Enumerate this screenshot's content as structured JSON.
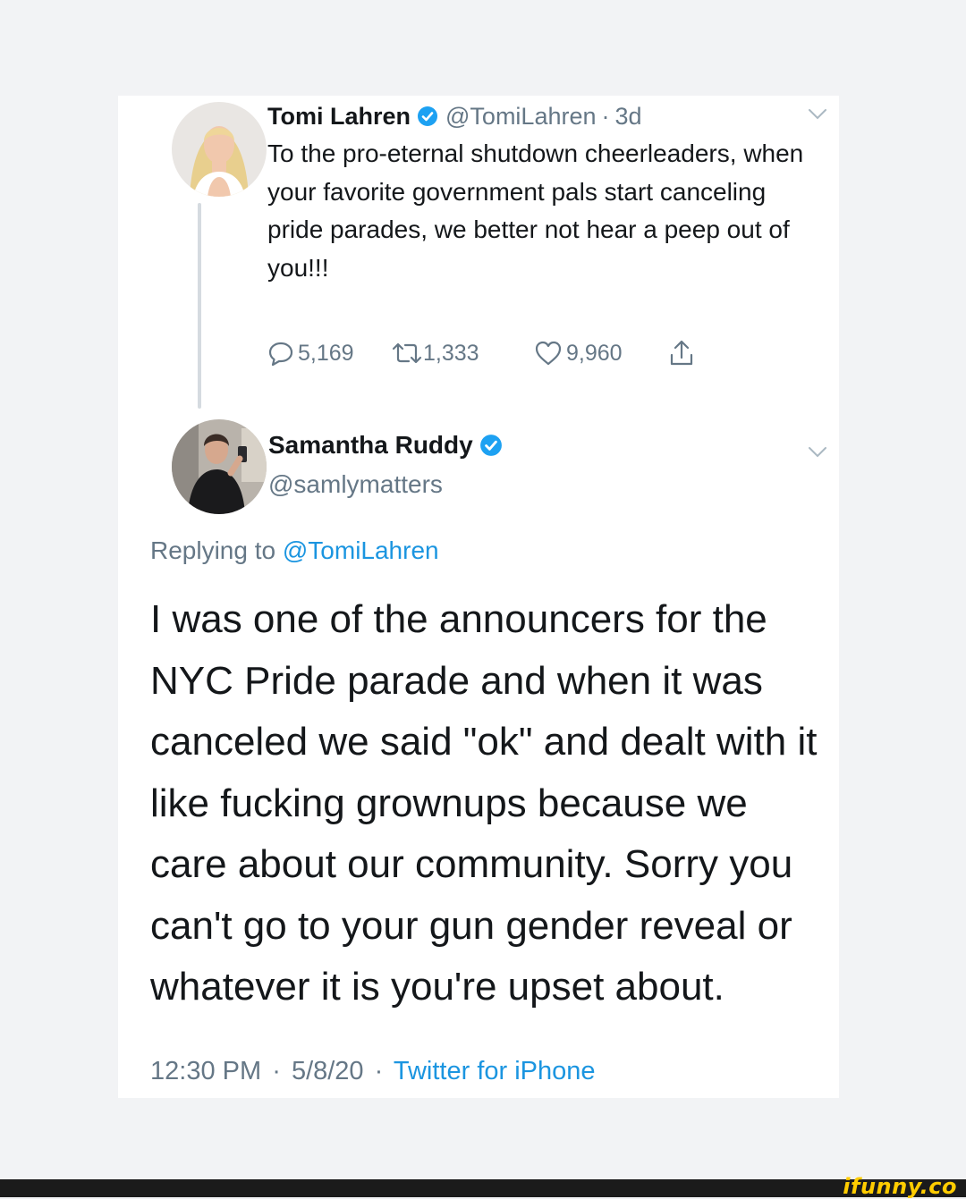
{
  "tweet1": {
    "name": "Tomi Lahren",
    "handle": "@TomiLahren",
    "separator": "·",
    "time_ago": "3d",
    "text": "To the pro-eternal shutdown cheerleaders, when your favorite government pals start canceling pride parades, we better not hear a peep out of you!!!",
    "replies": "5,169",
    "retweets": "1,333",
    "likes": "9,960"
  },
  "tweet2": {
    "name": "Samantha Ruddy",
    "handle": "@samlymatters",
    "replying_prefix": "Replying to",
    "replying_handle": "@TomiLahren",
    "text": "I was one of the announcers for the NYC Pride parade and when it was canceled we said \"ok\" and dealt with it like fucking grownups because we care about our community. Sorry you can't go to your gun gender reveal or whatever it is you're upset about.",
    "time": "12:30 PM",
    "separator": "·",
    "date": "5/8/20",
    "source": "Twitter for iPhone"
  },
  "watermark": "ifunny.co",
  "colors": {
    "background": "#f2f3f5",
    "card": "#ffffff",
    "text": "#14171a",
    "muted": "#657786",
    "link": "#1b95e0",
    "verified": "#1da1f2",
    "watermark": "#ffcc00"
  },
  "icons": [
    "verified-badge-icon",
    "reply-icon",
    "retweet-icon",
    "like-icon",
    "share-icon",
    "chevron-down-icon"
  ]
}
